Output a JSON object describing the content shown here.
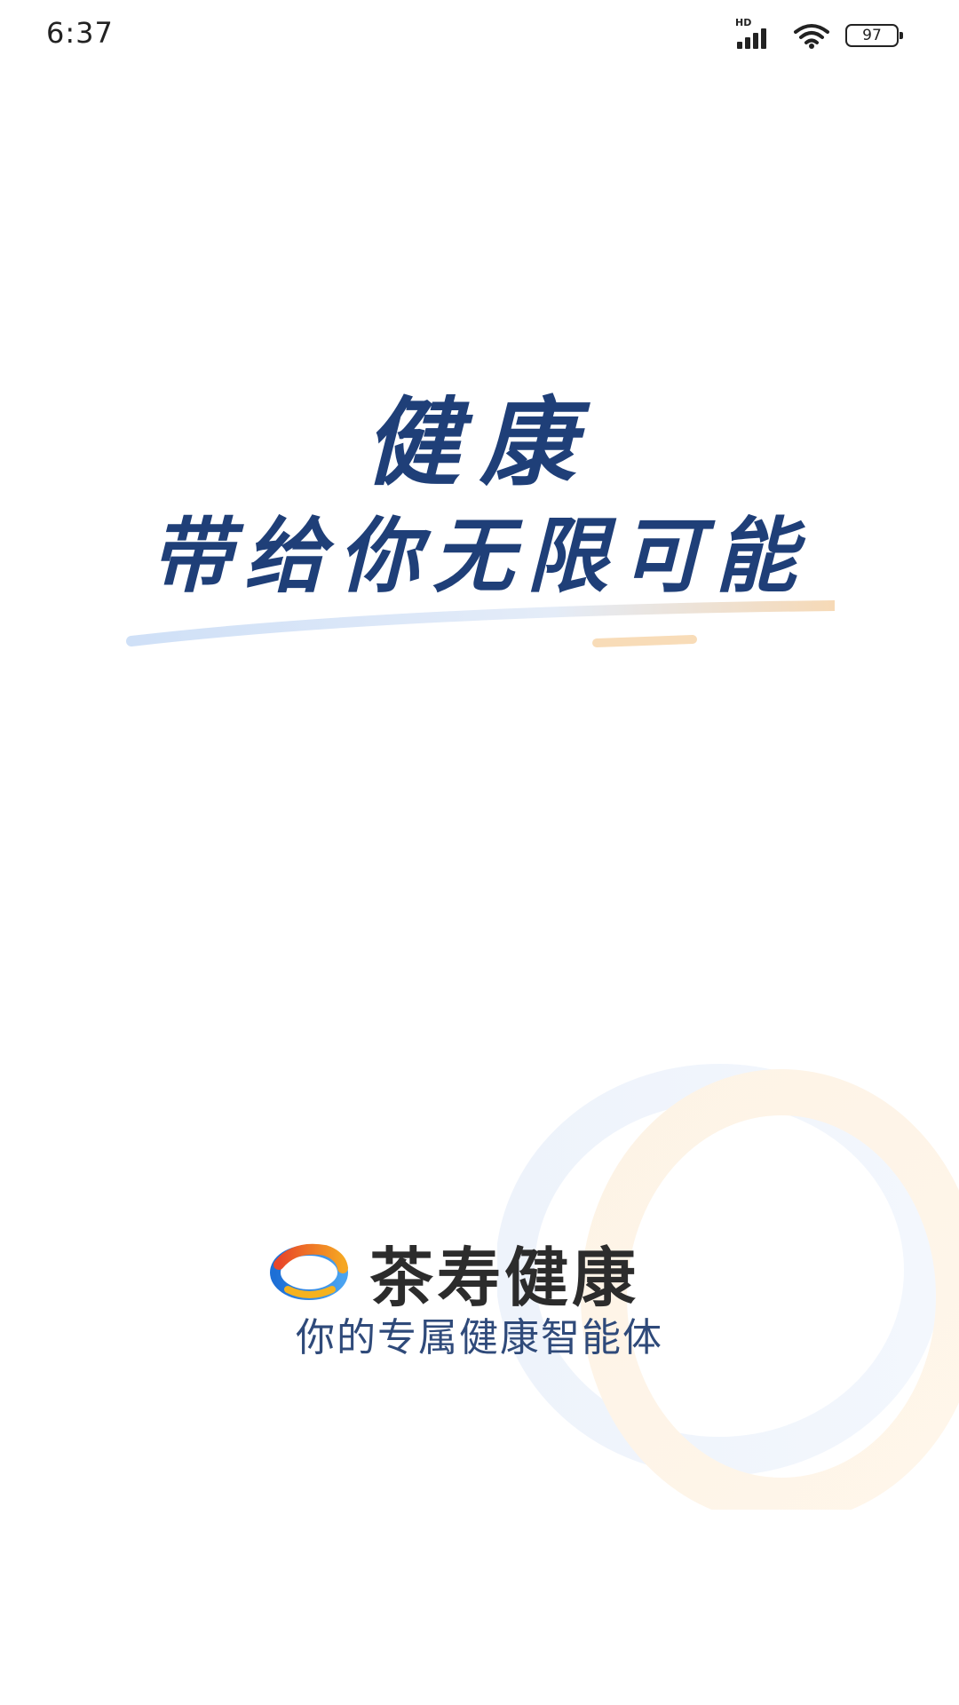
{
  "status_bar": {
    "time": "6:37",
    "network_label": "HD",
    "battery_level": "97"
  },
  "slogan": {
    "line1": "健康",
    "line2": "带给你无限可能"
  },
  "brand": {
    "name": "茶寿健康",
    "tagline": "你的专属健康智能体"
  },
  "colors": {
    "slogan": "#1f3f78",
    "brand_text": "#2c2c2c",
    "tagline": "#2f4a7a",
    "logo_orange": "#f39a1e",
    "logo_blue": "#2a72c9"
  },
  "icons": [
    "signal-icon",
    "wifi-icon",
    "battery-icon",
    "brand-logo-icon"
  ]
}
